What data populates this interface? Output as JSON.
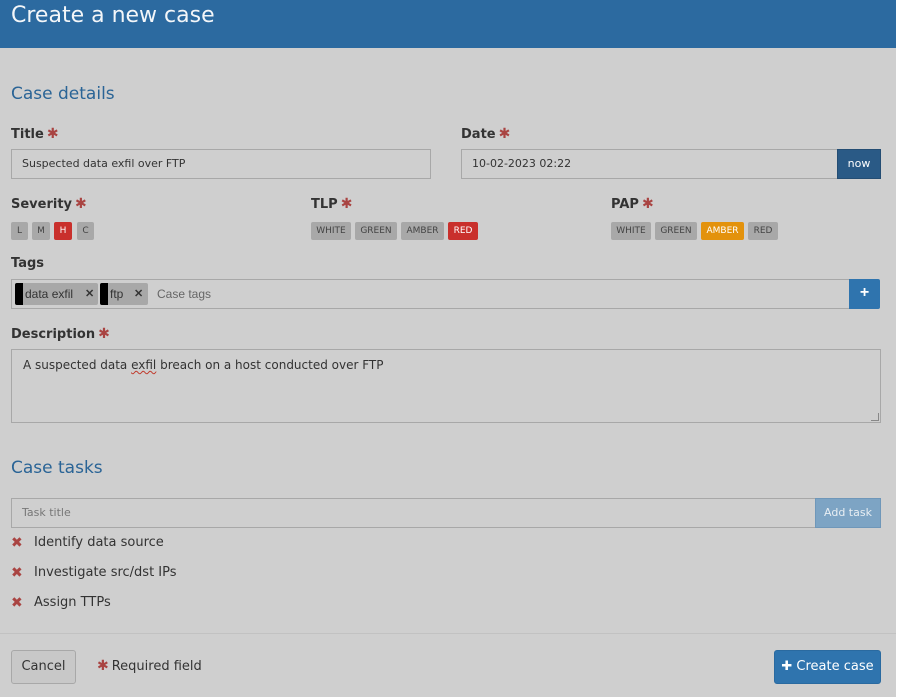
{
  "modal": {
    "title": "Create a new case"
  },
  "sections": {
    "details": "Case details",
    "tasks": "Case tasks"
  },
  "fields": {
    "title": {
      "label": "Title",
      "value": "Suspected data exfil over FTP"
    },
    "date": {
      "label": "Date",
      "value": "10-02-2023 02:22",
      "now_label": "now"
    },
    "severity": {
      "label": "Severity",
      "options": [
        "L",
        "M",
        "H",
        "C"
      ],
      "selected": "H"
    },
    "tlp": {
      "label": "TLP",
      "options": [
        "WHITE",
        "GREEN",
        "AMBER",
        "RED"
      ],
      "selected": "RED"
    },
    "pap": {
      "label": "PAP",
      "options": [
        "WHITE",
        "GREEN",
        "AMBER",
        "RED"
      ],
      "selected": "AMBER"
    },
    "tags": {
      "label": "Tags",
      "items": [
        "data exfil",
        "ftp"
      ],
      "placeholder": "Case tags",
      "add_icon": "plus-icon"
    },
    "description": {
      "label": "Description",
      "value_pre": "A suspected data ",
      "value_mis": "exfil",
      "value_post": " breach on a host conducted over FTP"
    }
  },
  "tasks": {
    "input_placeholder": "Task title",
    "add_label": "Add task",
    "items": [
      "Identify data source",
      "Investigate src/dst IPs",
      "Assign TTPs"
    ]
  },
  "footer": {
    "cancel_label": "Cancel",
    "required_note": "Required field",
    "create_label": "Create case",
    "create_icon": "plus-icon"
  },
  "colors": {
    "header": "#2c6aa0",
    "accent": "#2f74ae",
    "danger": "#c9302c",
    "amber": "#e3920c"
  }
}
